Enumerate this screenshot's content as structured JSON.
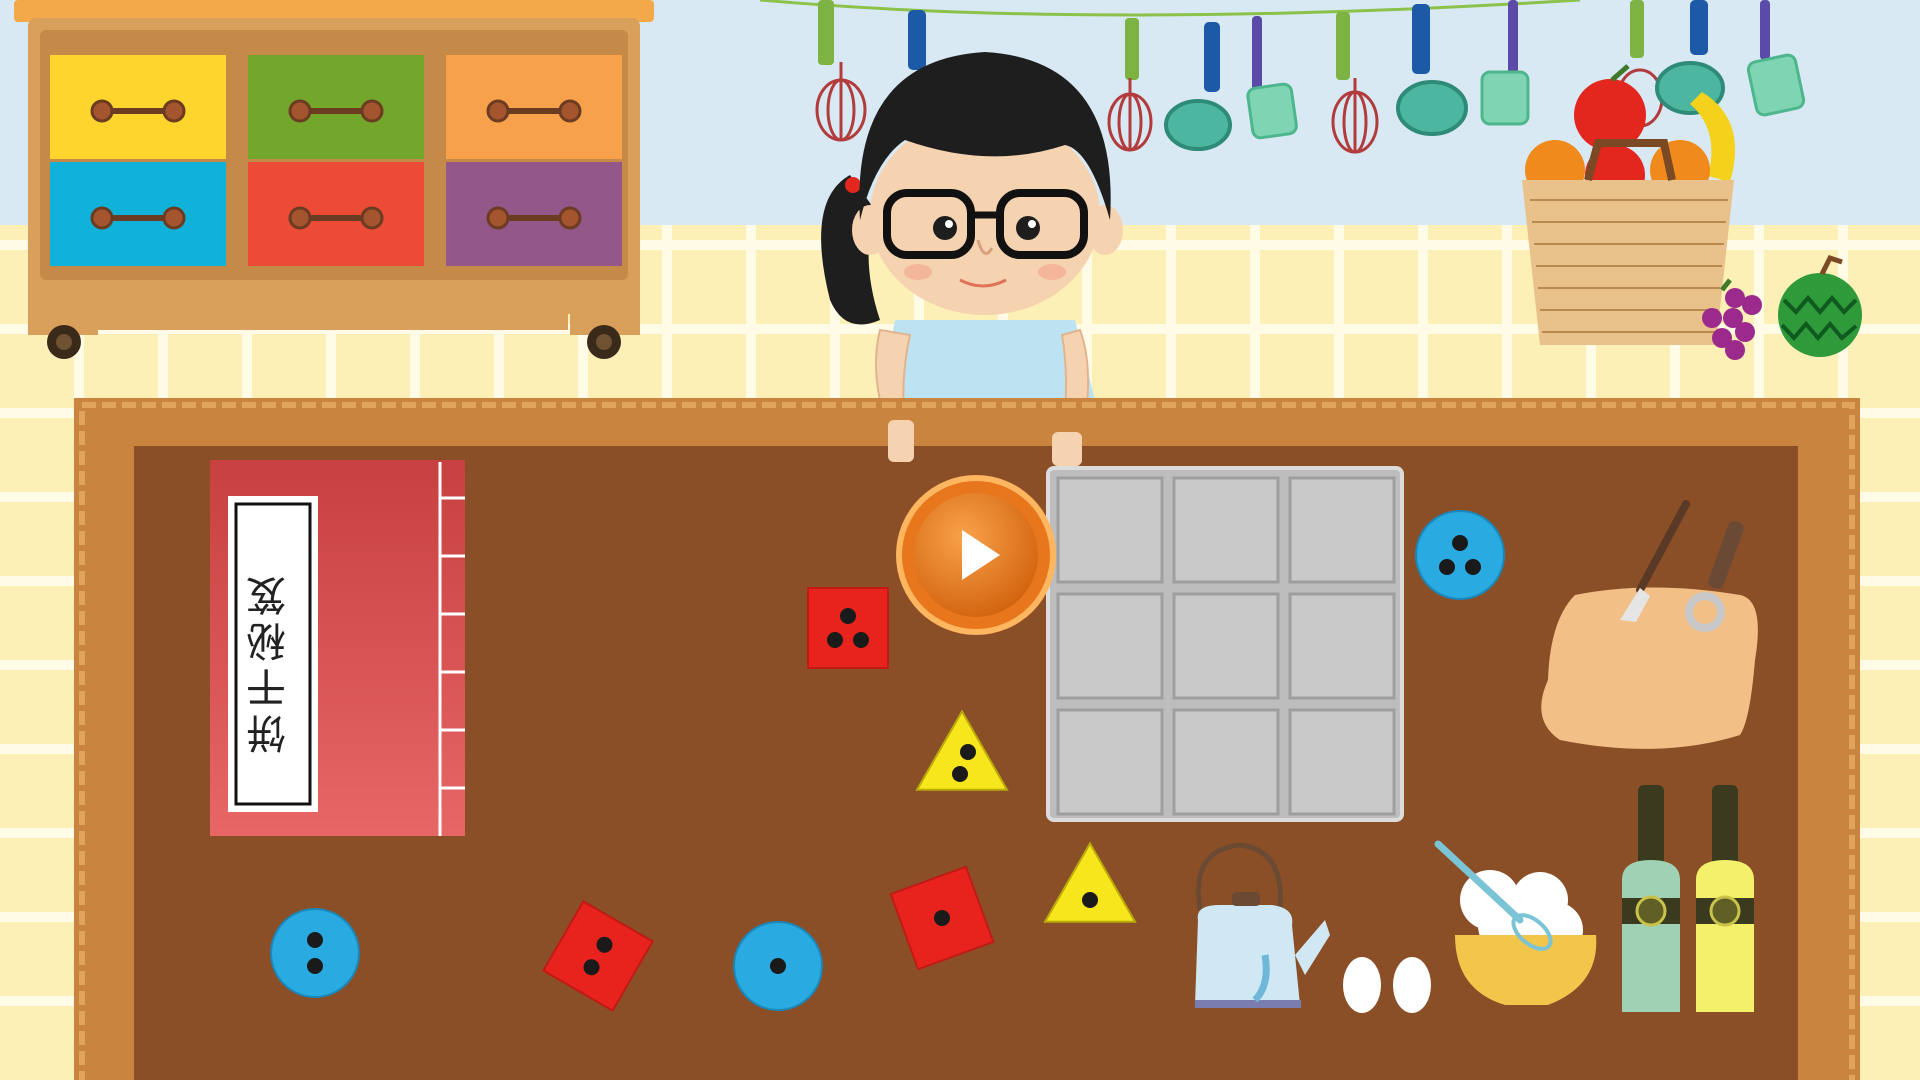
{
  "scene": {
    "type": "kitchen-shape-sorting-puzzle",
    "cookbook": {
      "title": "饼干秘笈"
    },
    "grid": {
      "rows": 3,
      "cols": 3
    },
    "colors": {
      "table": "#8b4f28",
      "table_frame": "#c9853f",
      "grid_tray": "#a9a9a9",
      "grid_cell": "#c9c9c9",
      "play_button": "#e8761c",
      "shape_red": "#e8231e",
      "shape_blue": "#29aae1",
      "shape_yellow": "#f6e61b"
    },
    "drawers": [
      {
        "color": "#fed52c"
      },
      {
        "color": "#72a72b"
      },
      {
        "color": "#f7a14a"
      },
      {
        "color": "#11b2d9"
      },
      {
        "color": "#ec4b35"
      },
      {
        "color": "#93578a"
      }
    ],
    "pieces": [
      {
        "shape": "square",
        "color": "red",
        "dots": 3
      },
      {
        "shape": "circle",
        "color": "blue",
        "dots": 3
      },
      {
        "shape": "triangle",
        "color": "yellow",
        "dots": 2
      },
      {
        "shape": "circle",
        "color": "blue",
        "dots": 2
      },
      {
        "shape": "square",
        "color": "red",
        "dots": 2
      },
      {
        "shape": "circle",
        "color": "blue",
        "dots": 1
      },
      {
        "shape": "square",
        "color": "red",
        "dots": 1
      },
      {
        "shape": "triangle",
        "color": "yellow",
        "dots": 1
      }
    ]
  }
}
